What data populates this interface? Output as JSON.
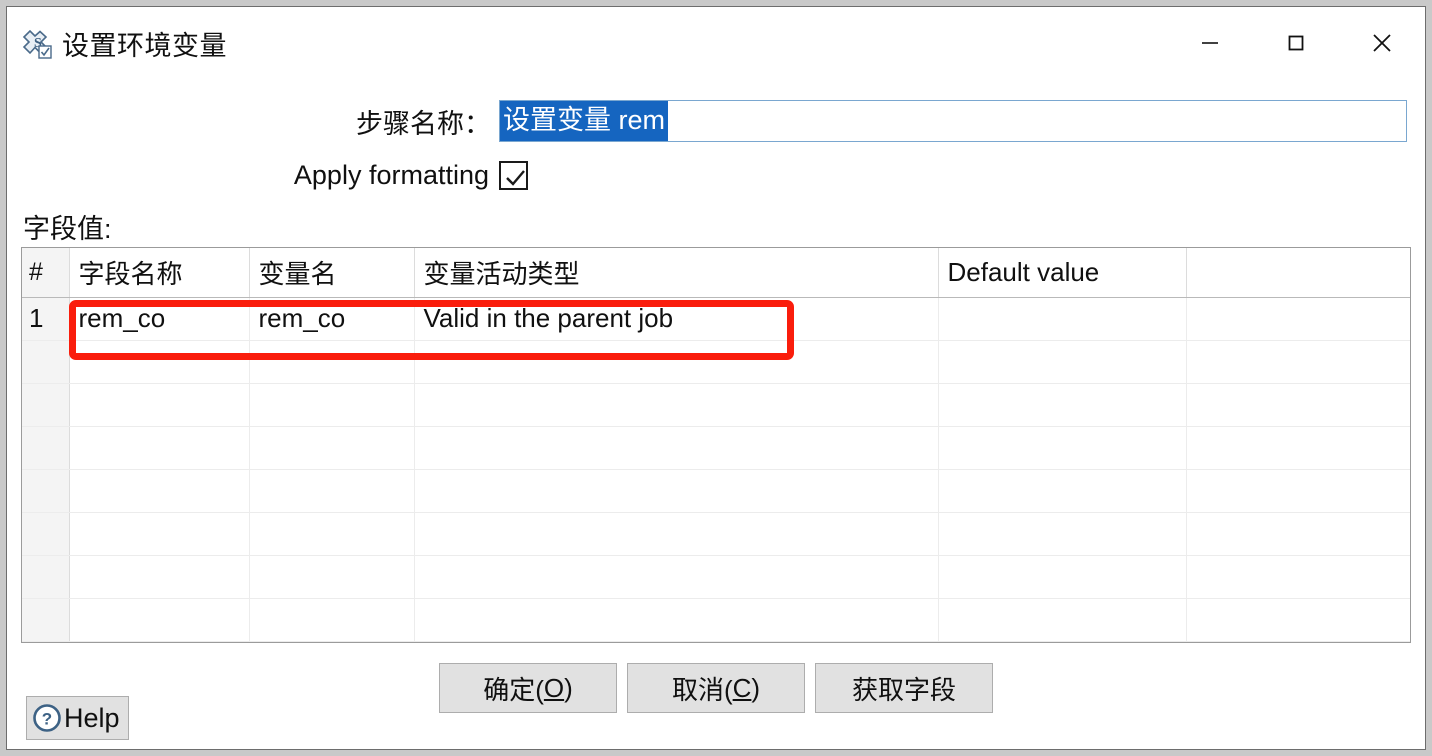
{
  "window": {
    "title": "设置环境变量",
    "icon": "set-variable-icon",
    "controls": {
      "minimize": "minimize-icon",
      "maximize": "maximize-icon",
      "close": "close-icon"
    }
  },
  "form": {
    "step_name_label": "步骤名称：",
    "step_name_value": "设置变量 rem",
    "apply_formatting_label": "Apply formatting",
    "apply_formatting_checked": true,
    "field_values_label": "字段值:"
  },
  "grid": {
    "columns": [
      "#",
      "字段名称",
      "变量名",
      "变量活动类型",
      "Default value",
      ""
    ],
    "rows": [
      {
        "num": "1",
        "field_name": "rem_co",
        "variable_name": "rem_co",
        "variable_scope": "Valid in the parent job",
        "default_value": "",
        "extra": ""
      },
      {
        "num": "",
        "field_name": "",
        "variable_name": "",
        "variable_scope": "",
        "default_value": "",
        "extra": ""
      },
      {
        "num": "",
        "field_name": "",
        "variable_name": "",
        "variable_scope": "",
        "default_value": "",
        "extra": ""
      },
      {
        "num": "",
        "field_name": "",
        "variable_name": "",
        "variable_scope": "",
        "default_value": "",
        "extra": ""
      },
      {
        "num": "",
        "field_name": "",
        "variable_name": "",
        "variable_scope": "",
        "default_value": "",
        "extra": ""
      },
      {
        "num": "",
        "field_name": "",
        "variable_name": "",
        "variable_scope": "",
        "default_value": "",
        "extra": ""
      },
      {
        "num": "",
        "field_name": "",
        "variable_name": "",
        "variable_scope": "",
        "default_value": "",
        "extra": ""
      },
      {
        "num": "",
        "field_name": "",
        "variable_name": "",
        "variable_scope": "",
        "default_value": "",
        "extra": ""
      }
    ]
  },
  "annotation": {
    "color": "#fa1d0c",
    "shape": "rounded-rectangle"
  },
  "buttons": {
    "ok": "确定(O)",
    "ok_prefix": "确定(",
    "ok_mnemonic": "O",
    "ok_suffix": ")",
    "cancel_prefix": "取消(",
    "cancel_mnemonic": "C",
    "cancel_suffix": ")",
    "get_fields": "获取字段",
    "help": "Help",
    "help_icon": "question-mark-icon"
  },
  "colors": {
    "selection_blue": "#1565c0",
    "annotation_red": "#fa1d0c",
    "button_face": "#e1e1e1",
    "window_border": "#6d6d6d"
  }
}
